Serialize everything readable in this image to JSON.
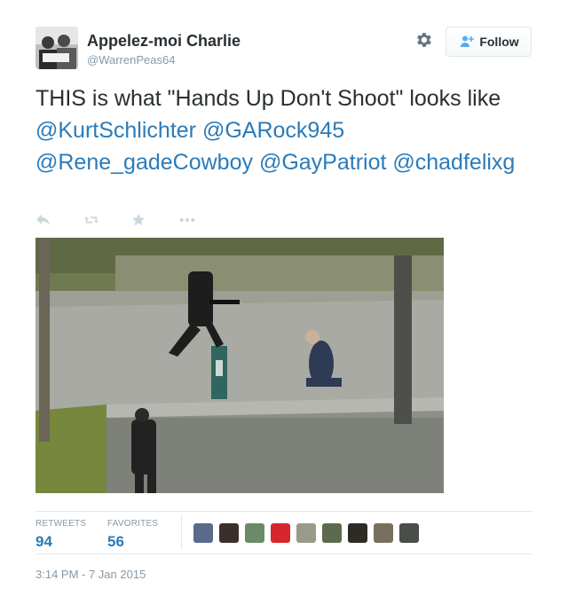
{
  "user": {
    "name": "Appelez-moi Charlie",
    "handle": "@WarrenPeas64"
  },
  "follow_button": {
    "label": "Follow"
  },
  "tweet": {
    "text_before": "THIS is what \"Hands Up Don't Shoot\" looks like",
    "mentions": [
      "@KurtSchlichter",
      "@GARock945",
      "@Rene_gadeCowboy",
      "@GayPatriot",
      "@chadfelixg"
    ]
  },
  "actions": {
    "icons": [
      "reply-icon",
      "retweet-icon",
      "favorite-icon",
      "more-icon"
    ]
  },
  "stats": {
    "retweets_label": "RETWEETS",
    "retweets_value": "94",
    "favorites_label": "FAVORITES",
    "favorites_value": "56"
  },
  "favoriters": [
    {
      "color": "#5a6a8a"
    },
    {
      "color": "#3a2f2a"
    },
    {
      "color": "#6b8a6a"
    },
    {
      "color": "#d8262e"
    },
    {
      "color": "#9a9a8a"
    },
    {
      "color": "#5c6b4e"
    },
    {
      "color": "#2e2a26"
    },
    {
      "color": "#7a6e5e"
    },
    {
      "color": "#4a4d49"
    }
  ],
  "timestamp": "3:14 PM - 7 Jan 2015",
  "colors": {
    "link": "#2b7bb9",
    "secondary_text": "#8899a6",
    "action_icon": "#ccd6dd"
  }
}
